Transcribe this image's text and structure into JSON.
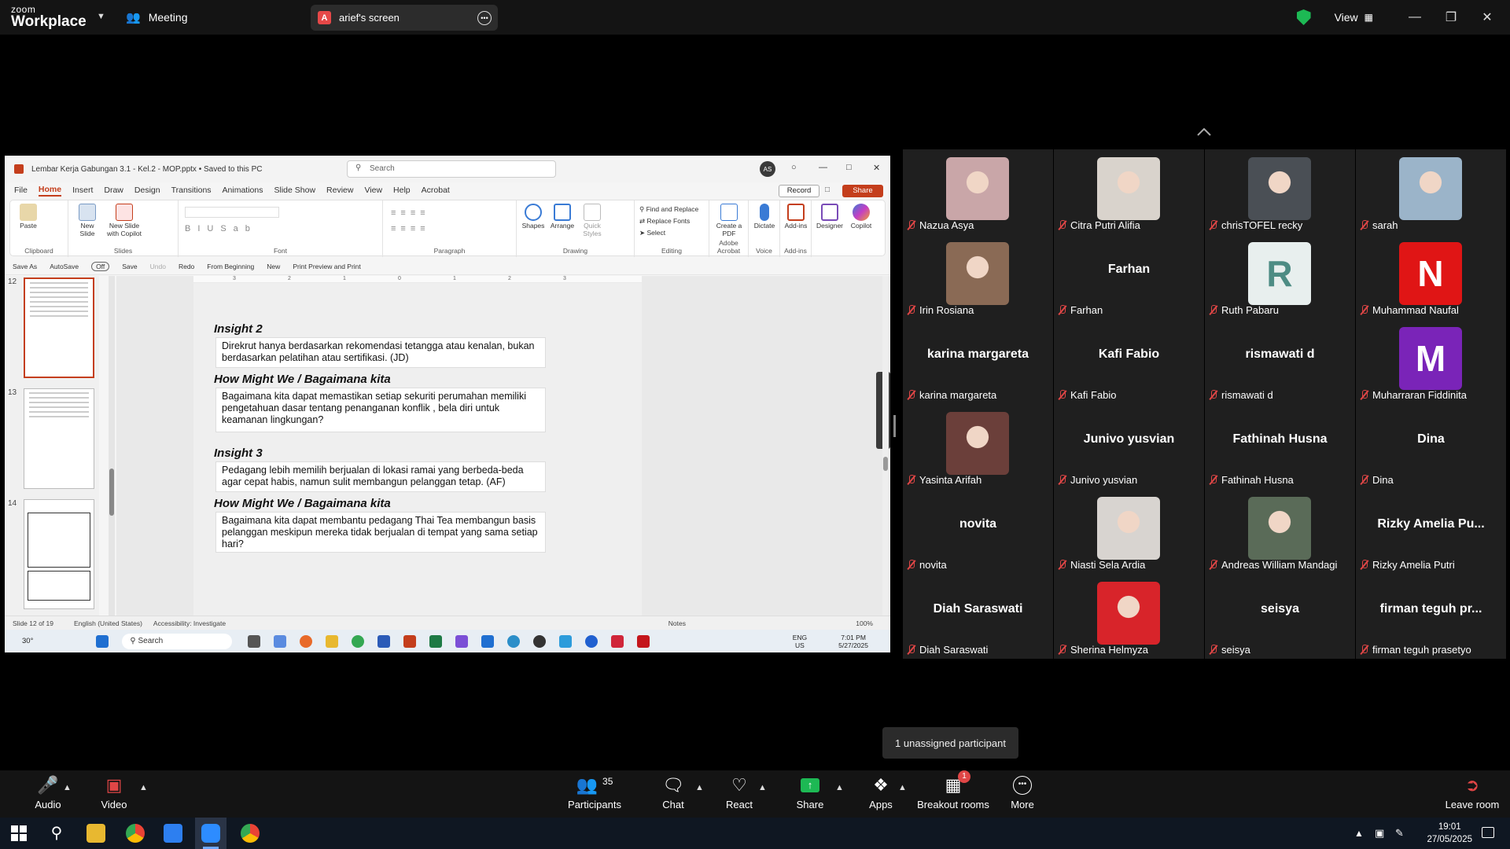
{
  "zoom": {
    "logo_line1": "zoom",
    "logo_line2": "Workplace",
    "meeting_label": "Meeting",
    "screen_badge": "A",
    "screen_label": "arief's screen",
    "view_label": "View",
    "unassigned": "1 unassigned participant",
    "toolbar": {
      "audio": "Audio",
      "video": "Video",
      "participants": "Participants",
      "participants_count": "35",
      "chat": "Chat",
      "react": "React",
      "share": "Share",
      "apps": "Apps",
      "breakout": "Breakout rooms",
      "breakout_badge": "1",
      "more": "More",
      "leave": "Leave room"
    }
  },
  "ppt": {
    "title": "Lembar Kerja Gabungan 3.1 - Kel.2 - MOP.pptx • Saved to this PC",
    "search_placeholder": "Search",
    "avatar": "AS",
    "menu": [
      "File",
      "Home",
      "Insert",
      "Draw",
      "Design",
      "Transitions",
      "Animations",
      "Slide Show",
      "Review",
      "View",
      "Help",
      "Acrobat"
    ],
    "record": "Record",
    "share": "Share",
    "ribbon": {
      "paste": "Paste",
      "new_slide": "New Slide",
      "new_slide_copilot": "New Slide with Copilot",
      "shapes": "Shapes",
      "arrange": "Arrange",
      "quick_styles": "Quick Styles",
      "find_replace": "Find and Replace",
      "replace_fonts": "Replace Fonts",
      "select": "Select",
      "create_pdf": "Create a PDF",
      "dictate": "Dictate",
      "addins": "Add-ins",
      "designer": "Designer",
      "copilot": "Copilot",
      "groups": [
        "Clipboard",
        "Slides",
        "Font",
        "Paragraph",
        "Drawing",
        "Editing",
        "Adobe Acrobat",
        "Voice",
        "Add-ins"
      ]
    },
    "qat": [
      "Save As",
      "AutoSave",
      "Off",
      "Save",
      "Undo",
      "Redo",
      "From Beginning",
      "New",
      "Print Preview and Print"
    ],
    "thumb_numbers": [
      "12",
      "13",
      "14"
    ],
    "ruler_ticks": [
      "3",
      "2",
      "1",
      "0",
      "1",
      "2",
      "3"
    ],
    "slide": {
      "insight2_h": "Insight 2",
      "insight2_t": "Direkrut hanya berdasarkan rekomendasi tetangga atau kenalan, bukan berdasarkan pelatihan atau sertifikasi. (JD)",
      "hmw1_h": "How Might We / Bagaimana kita",
      "hmw1_t": "Bagaimana kita dapat memastikan setiap sekuriti perumahan memiliki pengetahuan dasar tentang penanganan konflik , bela diri untuk keamanan lingkungan?",
      "insight3_h": "Insight 3",
      "insight3_t": "Pedagang lebih memilih berjualan di lokasi ramai yang berbeda-beda agar cepat habis, namun sulit membangun pelanggan tetap. (AF)",
      "hmw2_h": "How Might We / Bagaimana kita",
      "hmw2_t": "Bagaimana kita dapat membantu pedagang Thai Tea membangun basis pelanggan meskipun mereka tidak berjualan di tempat yang sama setiap hari?"
    },
    "status": {
      "slide": "Slide 12 of 19",
      "lang": "English (United States)",
      "accessibility": "Accessibility: Investigate",
      "notes": "Notes",
      "zoom": "100%"
    },
    "taskbar": {
      "temp": "30°",
      "search": "Search",
      "lang1": "ENG",
      "lang2": "US",
      "time": "7:01 PM",
      "date": "5/27/2025"
    }
  },
  "participants": [
    {
      "name": "Nazua Asya",
      "kind": "photo",
      "color": "#c9a6a8"
    },
    {
      "name": "Citra Putri Alifia",
      "kind": "photo",
      "color": "#d9d3cc"
    },
    {
      "name": "chrisTOFEL recky",
      "kind": "photo",
      "color": "#4a4f55"
    },
    {
      "name": "sarah",
      "kind": "photo",
      "color": "#9bb4c9"
    },
    {
      "name": "Irin Rosiana",
      "kind": "photo",
      "color": "#8a6a55"
    },
    {
      "name": "Farhan",
      "kind": "name",
      "big": "Farhan"
    },
    {
      "name": "Ruth Pabaru",
      "kind": "init",
      "init": "R",
      "color": "#e8efee",
      "fg": "#4d8c84"
    },
    {
      "name": "Muhammad Naufal",
      "kind": "init",
      "init": "N",
      "color": "#e01515",
      "fg": "#ffffff"
    },
    {
      "name": "karina margareta",
      "kind": "name",
      "big": "karina margareta"
    },
    {
      "name": "Kafi Fabio",
      "kind": "name",
      "big": "Kafi Fabio"
    },
    {
      "name": "rismawati d",
      "kind": "name",
      "big": "rismawati d"
    },
    {
      "name": "Muharraran Fiddinita",
      "kind": "init",
      "init": "M",
      "color": "#7a24b8",
      "fg": "#ffffff"
    },
    {
      "name": "Yasinta Arifah",
      "kind": "photo",
      "color": "#6b3f3a"
    },
    {
      "name": "Junivo yusvian",
      "kind": "name",
      "big": "Junivo yusvian"
    },
    {
      "name": "Fathinah Husna",
      "kind": "name",
      "big": "Fathinah Husna"
    },
    {
      "name": "Dina",
      "kind": "name",
      "big": "Dina"
    },
    {
      "name": "novita",
      "kind": "name",
      "big": "novita"
    },
    {
      "name": "Niasti Sela Ardia",
      "kind": "photo",
      "color": "#d8d4d0"
    },
    {
      "name": "Andreas William Mandagi",
      "kind": "photo",
      "color": "#5a6b58"
    },
    {
      "name": "Rizky Amelia Putri",
      "kind": "name",
      "big": "Rizky Amelia Pu..."
    },
    {
      "name": "Diah Saraswati",
      "kind": "name",
      "big": "Diah Saraswati"
    },
    {
      "name": "Sherina Helmyza",
      "kind": "photo",
      "color": "#d8242a"
    },
    {
      "name": "seisya",
      "kind": "name",
      "big": "seisya"
    },
    {
      "name": "firman teguh prasetyo",
      "kind": "name",
      "big": "firman teguh pr..."
    }
  ],
  "windows": {
    "time": "19:01",
    "date": "27/05/2025"
  }
}
